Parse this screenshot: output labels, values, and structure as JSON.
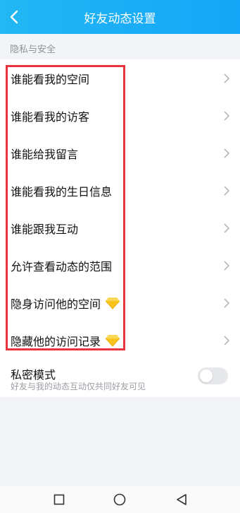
{
  "header": {
    "title": "好友动态设置",
    "back_icon": "chevron-left-icon"
  },
  "section": {
    "label": "隐私与安全"
  },
  "items": [
    {
      "label": "谁能看我的空间",
      "gem": false
    },
    {
      "label": "谁能看我的访客",
      "gem": false
    },
    {
      "label": "谁能给我留言",
      "gem": false
    },
    {
      "label": "谁能看我的生日信息",
      "gem": false
    },
    {
      "label": "谁能跟我互动",
      "gem": false
    },
    {
      "label": "允许查看动态的范围",
      "gem": false
    },
    {
      "label": "隐身访问他的空间",
      "gem": true
    },
    {
      "label": "隐藏他的访问记录",
      "gem": true
    }
  ],
  "private_mode": {
    "title": "私密模式",
    "subtitle": "好友与我的动态互动仅共同好友可见",
    "enabled": false
  },
  "colors": {
    "header": "#1aaef5",
    "highlight": "#e8343d",
    "gem": "#f7c21a"
  },
  "navbar": {
    "icons": [
      "square-icon",
      "circle-icon",
      "triangle-back-icon"
    ]
  }
}
